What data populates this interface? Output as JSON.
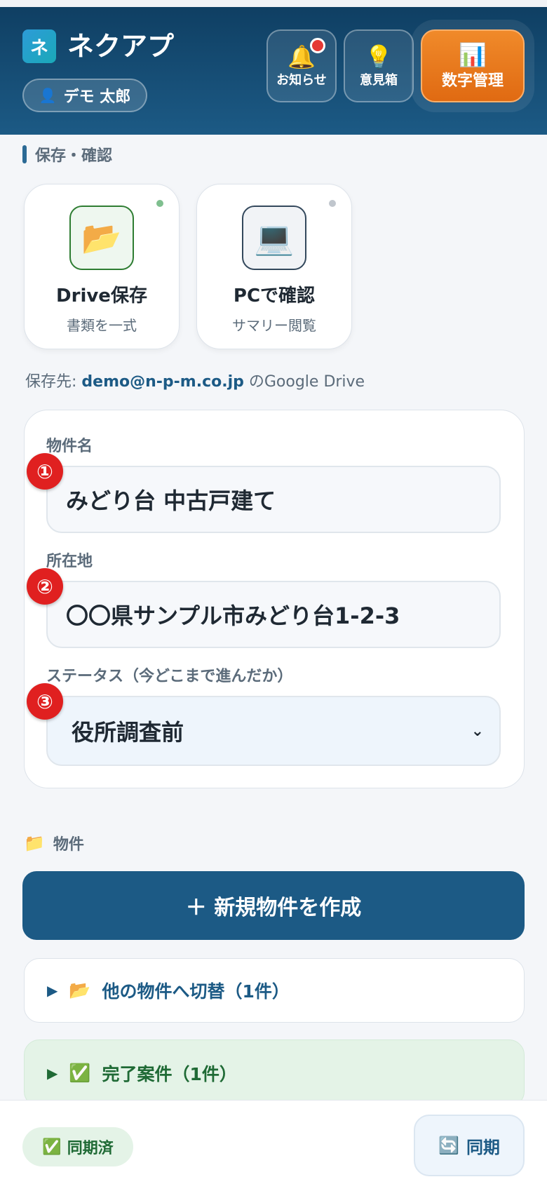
{
  "header": {
    "logo_char": "ネ",
    "app_title": "ネクアプ",
    "user_name": "デモ 太郎",
    "buttons": {
      "notice": "お知らせ",
      "idea": "意見箱",
      "numbers": "数字管理"
    }
  },
  "save_section": {
    "title": "保存・確認",
    "tiles": [
      {
        "title": "Drive保存",
        "subtitle": "書類を一式",
        "icon": "folder-icon"
      },
      {
        "title": "PCで確認",
        "subtitle": "サマリー閲覧",
        "icon": "laptop-icon"
      }
    ],
    "dest_prefix": "保存先: ",
    "dest_email": "demo@n-p-m.co.jp",
    "dest_suffix": " のGoogle Drive"
  },
  "form": {
    "property_name_label": "物件名",
    "property_name_value": "みどり台 中古戸建て",
    "address_label": "所在地",
    "address_value": "〇〇県サンプル市みどり台1-2-3",
    "status_label": "ステータス（今どこまで進んだか）",
    "status_value": "役所調査前",
    "markers": [
      "①",
      "②",
      "③"
    ]
  },
  "projects": {
    "title": "物件",
    "new_button": "＋ 新規物件を作成",
    "switch_label": "他の物件へ切替（1件）",
    "done_label": "完了案件（1件）"
  },
  "footer": {
    "synced_label": "同期済",
    "sync_button": "同期"
  },
  "colors": {
    "header": "#1c5a85",
    "accent_orange": "#e06a12",
    "alert_red": "#e02020",
    "success_green": "#1f6a35"
  }
}
